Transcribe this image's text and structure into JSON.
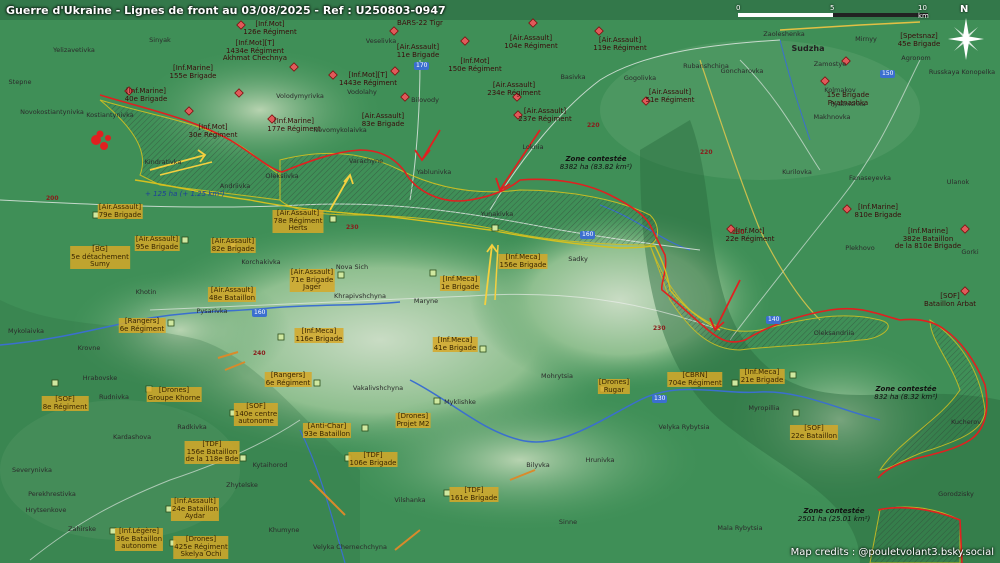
{
  "title": "Guerre d'Ukraine - Lignes de front au 03/08/2025 - Ref : U250803-0947",
  "credits": "Map credits : @pouletvolant3.bsky.social",
  "scale": {
    "t0": "0",
    "t5": "5",
    "t10": "10 km"
  },
  "compass": {
    "north": "N"
  },
  "colors": {
    "russia_line": "#e02020",
    "ukraine_line": "#d4c020",
    "ru_unit": "#e05a5a",
    "ua_unit": "#d6a828",
    "terrain": "#3f8f57",
    "river": "#3b6fcf"
  },
  "towns": [
    {
      "id": "sudzha",
      "name": "Sudzha",
      "big": true
    },
    {
      "id": "yunakivka",
      "name": "Yunakivka"
    },
    {
      "id": "andriivka",
      "name": "Andriivka"
    },
    {
      "id": "oleksiivka",
      "name": "Oleksiivka"
    },
    {
      "id": "varachyne",
      "name": "Varachyne"
    },
    {
      "id": "yablunivka",
      "name": "Yablunivka"
    },
    {
      "id": "loknia",
      "name": "Loknia"
    },
    {
      "id": "kindrativka",
      "name": "Kindrativka"
    },
    {
      "id": "yelizavetivka",
      "name": "Yelizavetivka"
    },
    {
      "id": "stepne",
      "name": "Stepne"
    },
    {
      "id": "novokostiantynivka",
      "name": "Novokostiantynivka"
    },
    {
      "id": "kostiantynivka",
      "name": "Kostiantynivka"
    },
    {
      "id": "vodolahy",
      "name": "Vodolahy"
    },
    {
      "id": "novomykolaivka",
      "name": "Novomykolaivka"
    },
    {
      "id": "volodymyrivka",
      "name": "Volodymyrivka"
    },
    {
      "id": "veselivka",
      "name": "Veselivka"
    },
    {
      "id": "bilovody",
      "name": "Bilovody"
    },
    {
      "id": "basivka",
      "name": "Basivka"
    },
    {
      "id": "hohalivka",
      "name": "Gogolivka"
    },
    {
      "id": "rubanshchina",
      "name": "Rubanshchina"
    },
    {
      "id": "zamostye",
      "name": "Zamostye"
    },
    {
      "id": "mirnyy",
      "name": "Mirnyy"
    },
    {
      "id": "agronom",
      "name": "Agronom"
    },
    {
      "id": "russkaya",
      "name": "Russkaya Konopelka"
    },
    {
      "id": "pyatnishka",
      "name": "Pyatnishka"
    },
    {
      "id": "kolmakov",
      "name": "Kolmakov"
    },
    {
      "id": "makhnovka",
      "name": "Makhnovka"
    },
    {
      "id": "zaoleshenka",
      "name": "Zaoleshenka"
    },
    {
      "id": "goncharovka",
      "name": "Goncharovka"
    },
    {
      "id": "kurilovka",
      "name": "Kurilovka"
    },
    {
      "id": "fanaseyevka",
      "name": "Fanaseyevka"
    },
    {
      "id": "ulanok",
      "name": "Ulanok"
    },
    {
      "id": "plekhovo",
      "name": "Plekhovo"
    },
    {
      "id": "gorki",
      "name": "Gorki"
    },
    {
      "id": "sadky",
      "name": "Sadky"
    },
    {
      "id": "maryne",
      "name": "Maryne"
    },
    {
      "id": "khrapivshchyna",
      "name": "Khrapivshchyna"
    },
    {
      "id": "novasich",
      "name": "Nova Sich"
    },
    {
      "id": "korchakivka",
      "name": "Korchakivka"
    },
    {
      "id": "pysarivka",
      "name": "Pysarivka"
    },
    {
      "id": "khotin",
      "name": "Khotin"
    },
    {
      "id": "mykolaivka",
      "name": "Mykolaivka"
    },
    {
      "id": "kirovka",
      "name": "Krovne"
    },
    {
      "id": "hrabovske",
      "name": "Hrabovske"
    },
    {
      "id": "oleksandriia",
      "name": "Oleksandriia"
    },
    {
      "id": "myropillia",
      "name": "Myropillia"
    },
    {
      "id": "mohrytsia",
      "name": "Mohrytsia"
    },
    {
      "id": "myklishke",
      "name": "Myklishke"
    },
    {
      "id": "vakalivshchyna",
      "name": "Vakalivshchyna"
    },
    {
      "id": "yunakivka2",
      "name": "Velyka Rybytsia"
    },
    {
      "id": "bilyvka",
      "name": "Bilyvka"
    },
    {
      "id": "hrunivka",
      "name": "Hrunivka"
    },
    {
      "id": "vilshanka",
      "name": "Vilshanka"
    },
    {
      "id": "sinne",
      "name": "Sinne"
    },
    {
      "id": "malarybytsia",
      "name": "Mala Rybytsia"
    },
    {
      "id": "kucherov",
      "name": "Kucherov"
    },
    {
      "id": "gorodzisky",
      "name": "Gorodzisky"
    },
    {
      "id": "rudnivka",
      "name": "Rudnivka"
    },
    {
      "id": "radkivka",
      "name": "Radkivka"
    },
    {
      "id": "kardashova",
      "name": "Kardashova"
    },
    {
      "id": "severynivka",
      "name": "Severynivka"
    },
    {
      "id": "perekhrestivka",
      "name": "Perekhrestivka"
    },
    {
      "id": "hrytsenkove",
      "name": "Hrytsenkove"
    },
    {
      "id": "zahirske",
      "name": "Zahirske"
    },
    {
      "id": "kytaihorod",
      "name": "Kytaihorod"
    },
    {
      "id": "khumyne",
      "name": "Khumyne"
    },
    {
      "id": "zhytelske",
      "name": "Zhytelske"
    },
    {
      "id": "velykachernechchyna",
      "name": "Velyka Chernechchyna"
    },
    {
      "id": "synyak",
      "name": "Sinyak"
    }
  ],
  "ru_units": [
    {
      "id": "ru1",
      "text": "[Inf.Mot]\n126e Régiment"
    },
    {
      "id": "ru2",
      "text": "BARS-22 Tigr"
    },
    {
      "id": "ru3",
      "text": "[Inf.Mot][T]\n1434e Régiment\nAkhmat Chechnya"
    },
    {
      "id": "ru4",
      "text": "[Inf.Marine]\n155e Brigade"
    },
    {
      "id": "ru5",
      "text": "[Air.Assault]\n11e Brigade"
    },
    {
      "id": "ru6",
      "text": "[Inf.Mot]\n150e Régiment"
    },
    {
      "id": "ru7",
      "text": "[Air.Assault]\n104e Régiment"
    },
    {
      "id": "ru8",
      "text": "[Air.Assault]\n119e Régiment"
    },
    {
      "id": "ru9",
      "text": "[Spetsnaz]\n45e Brigade"
    },
    {
      "id": "ru10",
      "text": "[Inf.Mot][T]\n1443e Régiment"
    },
    {
      "id": "ru11",
      "text": "[Inf.Marine]\n40e Brigade"
    },
    {
      "id": "ru12",
      "text": "[Inf.Mot]\n30e Régiment"
    },
    {
      "id": "ru13",
      "text": "[Inf.Marine]\n177e Régiment"
    },
    {
      "id": "ru14",
      "text": "[Air.Assault]\n83e Brigade"
    },
    {
      "id": "ru15",
      "text": "[Air.Assault]\n234e Régiment"
    },
    {
      "id": "ru16",
      "text": "[Air.Assault]\n237e Régiment"
    },
    {
      "id": "ru17",
      "text": "[Air.Assault]\n51e Régiment"
    },
    {
      "id": "ru18",
      "text": "15e Brigade\nPyatnashka"
    },
    {
      "id": "ru19",
      "text": "[Inf.Mot]\n22e Régiment"
    },
    {
      "id": "ru20",
      "text": "[Inf.Marine]\n810e Brigade"
    },
    {
      "id": "ru21",
      "text": "[Inf.Marine]\n382e Bataillon\nde la 810e Brigade"
    },
    {
      "id": "ru22",
      "text": "[SOF]\nBataillon Arbat"
    }
  ],
  "ua_units": [
    {
      "id": "ua1",
      "text": "[Air.Assault]\n79e Brigade"
    },
    {
      "id": "ua2",
      "text": "[BG]\n5e détachement\nSumy"
    },
    {
      "id": "ua3",
      "text": "[Air.Assault]\n95e Brigade"
    },
    {
      "id": "ua4",
      "text": "[Air.Assault]\n82e Brigade"
    },
    {
      "id": "ua5",
      "text": "[Air.Assault]\n78e Régiment\nHerts"
    },
    {
      "id": "ua6",
      "text": "[Air.Assault]\n71e Brigade\nJager"
    },
    {
      "id": "ua7",
      "text": "[Inf.Meca]\n1e Brigade"
    },
    {
      "id": "ua8",
      "text": "[Inf.Meca]\n156e Brigade"
    },
    {
      "id": "ua9",
      "text": "[Air.Assault]\n48e Bataillon"
    },
    {
      "id": "ua10",
      "text": "[Rangers]\n6e Régiment"
    },
    {
      "id": "ua11",
      "text": "[Inf.Meca]\n116e Brigade"
    },
    {
      "id": "ua12",
      "text": "[Inf.Meca]\n41e Brigade"
    },
    {
      "id": "ua13",
      "text": "[SOF]\n8e Régiment"
    },
    {
      "id": "ua14",
      "text": "[Drones]\nGroupe Khorne"
    },
    {
      "id": "ua15",
      "text": "[Rangers]\n6e Régiment"
    },
    {
      "id": "ua16",
      "text": "[SOF]\n140e centre\nautonome"
    },
    {
      "id": "ua17",
      "text": "[Drones]\nProjet M2"
    },
    {
      "id": "ua18",
      "text": "[Anti-Char]\n93e Bataillon"
    },
    {
      "id": "ua19",
      "text": "[Drones]\nRugar"
    },
    {
      "id": "ua20",
      "text": "[CBRN]\n704e Régiment"
    },
    {
      "id": "ua21",
      "text": "[Inf.Meca]\n21e Brigade"
    },
    {
      "id": "ua22",
      "text": "[TDF]\n156e Bataillon\nde la 118e Bde"
    },
    {
      "id": "ua23",
      "text": "[TDF]\n106e Brigade"
    },
    {
      "id": "ua24",
      "text": "[SOF]\n22e Bataillon"
    },
    {
      "id": "ua25",
      "text": "[Inf.Assault]\n24e Bataillon\nAydar"
    },
    {
      "id": "ua26",
      "text": "[TDF]\n161e Brigade"
    },
    {
      "id": "ua27",
      "text": "[Inf.Légère]\n36e Bataillon\nautonome"
    },
    {
      "id": "ua28",
      "text": "[Drones]\n425e Régiment\nSkelya Ochi"
    }
  ],
  "zones": [
    {
      "id": "z1",
      "title": "Zone contestée",
      "value": "8382 ha (83.82 km²)"
    },
    {
      "id": "z2",
      "title": "Zone contestée",
      "value": "832 ha (8.32 km²)"
    },
    {
      "id": "z3",
      "title": "Zone contestée",
      "value": "2501 ha (25.01 km²)"
    }
  ],
  "notes": [
    {
      "id": "n1",
      "text": "+ 125 ha (+ 1.25 km²)"
    }
  ],
  "roads": [
    {
      "id": "r1",
      "text": "200",
      "red": true
    },
    {
      "id": "r2",
      "text": "170",
      "red": false
    },
    {
      "id": "r3",
      "text": "220",
      "red": true
    },
    {
      "id": "r4",
      "text": "220",
      "red": true
    },
    {
      "id": "r5",
      "text": "230",
      "red": true
    },
    {
      "id": "r6",
      "text": "160",
      "red": false
    },
    {
      "id": "r7",
      "text": "160",
      "red": false
    },
    {
      "id": "r8",
      "text": "230",
      "red": true
    },
    {
      "id": "r9",
      "text": "240",
      "red": true
    },
    {
      "id": "r10",
      "text": "140",
      "red": false
    },
    {
      "id": "r11",
      "text": "130",
      "red": false
    },
    {
      "id": "r12",
      "text": "150",
      "red": false
    },
    {
      "id": "r13",
      "text": "230",
      "red": true
    }
  ]
}
